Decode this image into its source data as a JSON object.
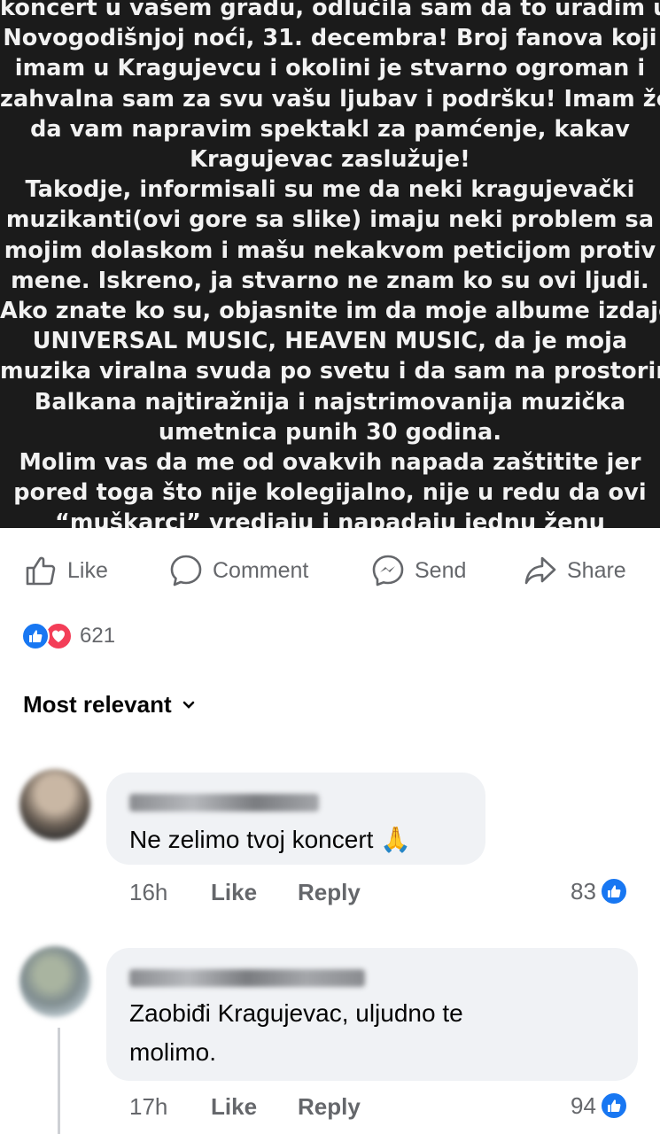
{
  "post": {
    "lines": [
      "koncert u vašem gradu, odlučila sam da to uradim u",
      "Novogodišnjoj noći, 31. decembra! Broj fanova koji",
      "imam u Kragujevcu i okolini je stvarno ogroman i",
      "zahvalna sam za svu vašu ljubav i podršku! Imam želju",
      "da vam napravim spektakl za pamćenje, kakav",
      "Kragujevac zaslužuje!",
      "Takodje, informisali su me da neki kragujevački",
      "muzikanti(ovi gore sa slike) imaju neki problem sa",
      "mojim dolaskom i mašu nekakvom peticijom protiv",
      "mene. Iskreno, ja stvarno ne znam ko su ovi ljudi.",
      "Ako znate ko su, objasnite im da moje albume izdaje",
      "UNIVERSAL MUSIC, HEAVEN MUSIC, da je moja",
      "muzika viralna svuda po svetu i da sam na prostorima",
      "Balkana najtiražnija i najstrimovanija muzička",
      "umetnica punih 30 godina.",
      "Molim vas da me od ovakvih napada zaštitite jer",
      "pored toga što nije kolegijalno, nije u redu da ovi",
      "“muškarci” vredjaju i napadaju jednu ženu"
    ]
  },
  "actions": {
    "like": "Like",
    "comment": "Comment",
    "send": "Send",
    "share": "Share"
  },
  "reactions": {
    "count": "621"
  },
  "sort": {
    "label": "Most relevant"
  },
  "comments": [
    {
      "text": "Ne zelimo tvoj koncert 🙏",
      "time": "16h",
      "like": "Like",
      "reply": "Reply",
      "likes": "83"
    },
    {
      "text_line1": "Zaobiđi Kragujevac, uljudno te",
      "text_line2": "molimo.",
      "time": "17h",
      "like": "Like",
      "reply": "Reply",
      "likes": "94"
    }
  ],
  "colors": {
    "post_bg": "#1b1b1b",
    "like_blue": "#1877f2",
    "love_red": "#f33e58",
    "meta_gray": "#65676b",
    "bubble": "#f0f2f5"
  }
}
